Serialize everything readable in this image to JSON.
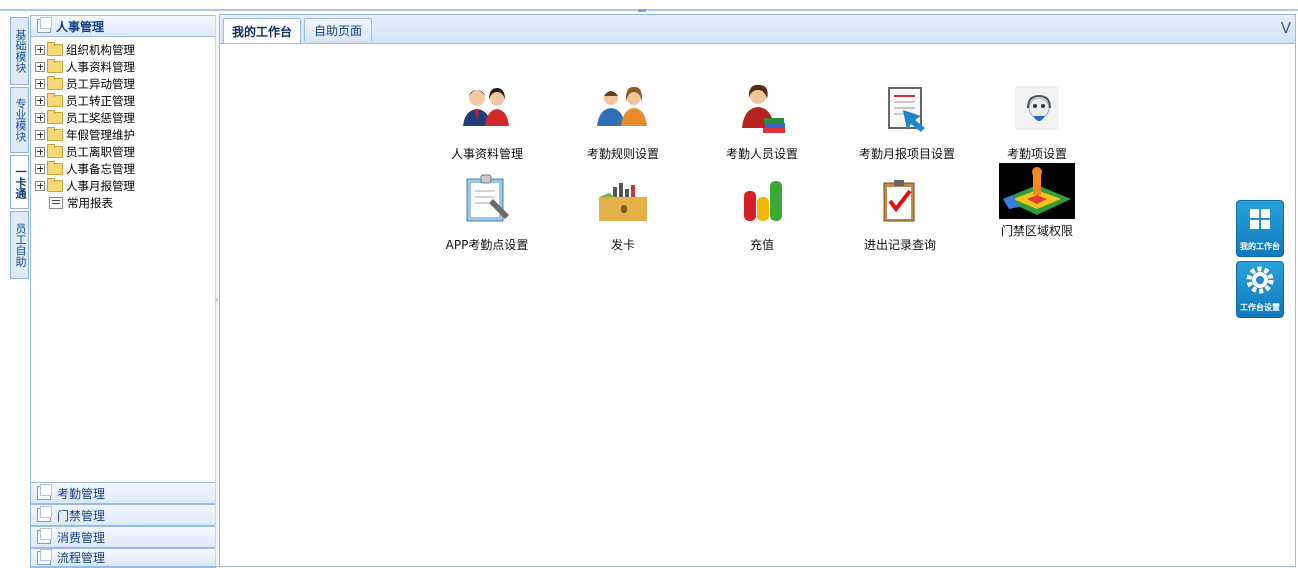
{
  "vertical_tabs": [
    {
      "label": "基础模块"
    },
    {
      "label": "专业模块"
    },
    {
      "label": "一卡通"
    },
    {
      "label": "员工自助"
    }
  ],
  "left_panel": {
    "title": "人事管理",
    "tree_items": [
      {
        "label": "组织机构管理"
      },
      {
        "label": "人事资料管理"
      },
      {
        "label": "员工异动管理"
      },
      {
        "label": "员工转正管理"
      },
      {
        "label": "员工奖惩管理"
      },
      {
        "label": "年假管理维护"
      },
      {
        "label": "员工离职管理"
      },
      {
        "label": "人事备忘管理"
      },
      {
        "label": "人事月报管理"
      }
    ],
    "report_item": "常用报表"
  },
  "accordion": [
    {
      "label": "考勤管理"
    },
    {
      "label": "门禁管理"
    },
    {
      "label": "消费管理"
    },
    {
      "label": "流程管理"
    }
  ],
  "tabs": [
    {
      "label": "我的工作台",
      "active": true
    },
    {
      "label": "自助页面",
      "active": false
    }
  ],
  "tab_menu_glyph": "V",
  "tiles": [
    {
      "label": "人事资料管理",
      "icon": "personnel-icon"
    },
    {
      "label": "考勤规则设置",
      "icon": "attendance-rules-icon"
    },
    {
      "label": "考勤人员设置",
      "icon": "attendance-staff-icon"
    },
    {
      "label": "考勤月报项目设置",
      "icon": "monthly-report-icon"
    },
    {
      "label": "考勤项设置",
      "icon": "attendance-item-icon"
    },
    {
      "label": "APP考勤点设置",
      "icon": "app-attendance-icon"
    },
    {
      "label": "发卡",
      "icon": "issue-card-icon"
    },
    {
      "label": "充值",
      "icon": "recharge-icon"
    },
    {
      "label": "进出记录查询",
      "icon": "access-record-icon"
    },
    {
      "label": "门禁区域权限",
      "icon": "access-zone-icon"
    }
  ],
  "side_buttons": [
    {
      "label": "我的工作台",
      "icon": "workspace-grid-icon"
    },
    {
      "label": "工作台设置",
      "icon": "settings-gear-icon"
    }
  ]
}
